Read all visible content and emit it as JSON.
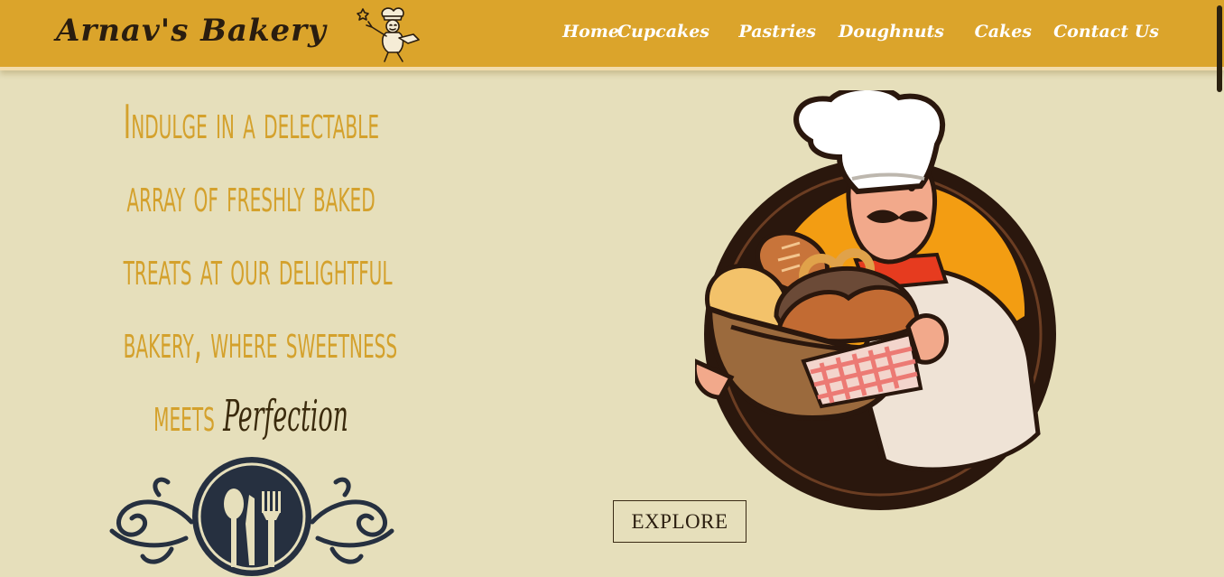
{
  "header": {
    "brand": "Arnav's Bakery",
    "logo_icon": "chef-mascot-icon"
  },
  "nav": {
    "items": [
      {
        "label": "Home"
      },
      {
        "label": "Cupcakes"
      },
      {
        "label": "Pastries"
      },
      {
        "label": "Doughnuts"
      },
      {
        "label": "Cakes"
      },
      {
        "label": "Contact Us"
      }
    ]
  },
  "hero": {
    "lines": [
      "Indulge in a delectable",
      "array of freshly baked",
      "treats at our delightful",
      "bakery, where sweetness"
    ],
    "last_line_prefix": "meets",
    "accent_word": "Perfection",
    "cta_label": "EXPLORE"
  },
  "colors": {
    "header_bg": "#dba42b",
    "page_bg": "#e6dfbb",
    "headline": "#d4a12c",
    "accent_text": "#3a2a0c",
    "nav_text": "#ffffff"
  }
}
